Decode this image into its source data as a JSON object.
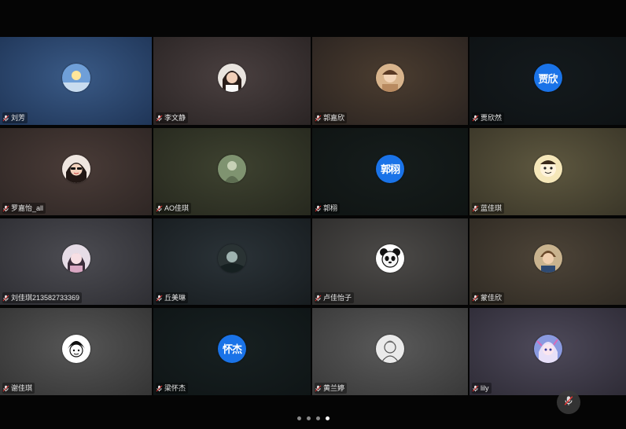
{
  "meeting": {
    "participants": [
      {
        "name": "刘芳",
        "avatar_type": "image",
        "avatar_icon": "sky-sun-avatar",
        "bg": [
          "#3a5a86",
          "#1f3557"
        ]
      },
      {
        "name": "李文静",
        "avatar_type": "image",
        "avatar_icon": "girl-portrait-avatar",
        "bg": [
          "#4a4040",
          "#2a2424"
        ]
      },
      {
        "name": "郭嘉欣",
        "avatar_type": "image",
        "avatar_icon": "warm-portrait-avatar",
        "bg": [
          "#4b3d30",
          "#2a2320"
        ]
      },
      {
        "name": "贾欣然",
        "avatar_type": "text",
        "avatar_text": "贾欣",
        "bg": [
          "#141a1d",
          "#0e1214"
        ]
      },
      {
        "name": "罗嘉怡_all",
        "avatar_type": "image",
        "avatar_icon": "sunglasses-girl-avatar",
        "bg": [
          "#4a3c38",
          "#2e2624"
        ]
      },
      {
        "name": "AO佳琪",
        "avatar_type": "image",
        "avatar_icon": "green-figure-avatar",
        "bg": [
          "#3e4230",
          "#26281e"
        ]
      },
      {
        "name": "郭栩",
        "avatar_type": "text",
        "avatar_text": "郭栩",
        "bg": [
          "#161d1c",
          "#0f1413"
        ]
      },
      {
        "name": "蓝佳琪",
        "avatar_type": "image",
        "avatar_icon": "cartoon-avatar",
        "bg": [
          "#5e5840",
          "#3a3628"
        ]
      },
      {
        "name": "刘佳琪213582733369",
        "avatar_type": "image",
        "avatar_icon": "pink-girl-avatar",
        "bg": [
          "#4c4c52",
          "#2e2e33"
        ]
      },
      {
        "name": "丘美琳",
        "avatar_type": "image",
        "avatar_icon": "dark-scene-avatar",
        "bg": [
          "#2b3338",
          "#171c1f"
        ]
      },
      {
        "name": "卢佳怡子",
        "avatar_type": "image",
        "avatar_icon": "panda-avatar",
        "bg": [
          "#4c4a48",
          "#2d2c2b"
        ]
      },
      {
        "name": "蒙佳欣",
        "avatar_type": "image",
        "avatar_icon": "boy-portrait-avatar",
        "bg": [
          "#4d4438",
          "#2f2a23"
        ]
      },
      {
        "name": "谢佳琪",
        "avatar_type": "image",
        "avatar_icon": "bw-cartoon-avatar",
        "bg": [
          "#565656",
          "#343434"
        ]
      },
      {
        "name": "梁怀杰",
        "avatar_type": "text",
        "avatar_text": "怀杰",
        "bg": [
          "#172021",
          "#0f1516"
        ]
      },
      {
        "name": "黄兰婷",
        "avatar_type": "image",
        "avatar_icon": "sketch-avatar",
        "bg": [
          "#5a5a5a",
          "#383838"
        ]
      },
      {
        "name": "lily",
        "avatar_type": "image",
        "avatar_icon": "anime-avatar",
        "bg": [
          "#4e4a5a",
          "#2e2b36"
        ]
      }
    ]
  },
  "pagination": {
    "total": 4,
    "active": 3
  },
  "floating_mic": {
    "icon": "mic-muted-icon"
  },
  "colors": {
    "text_avatar": "#1a73e8",
    "mic_icon": "#f0f0f0"
  }
}
